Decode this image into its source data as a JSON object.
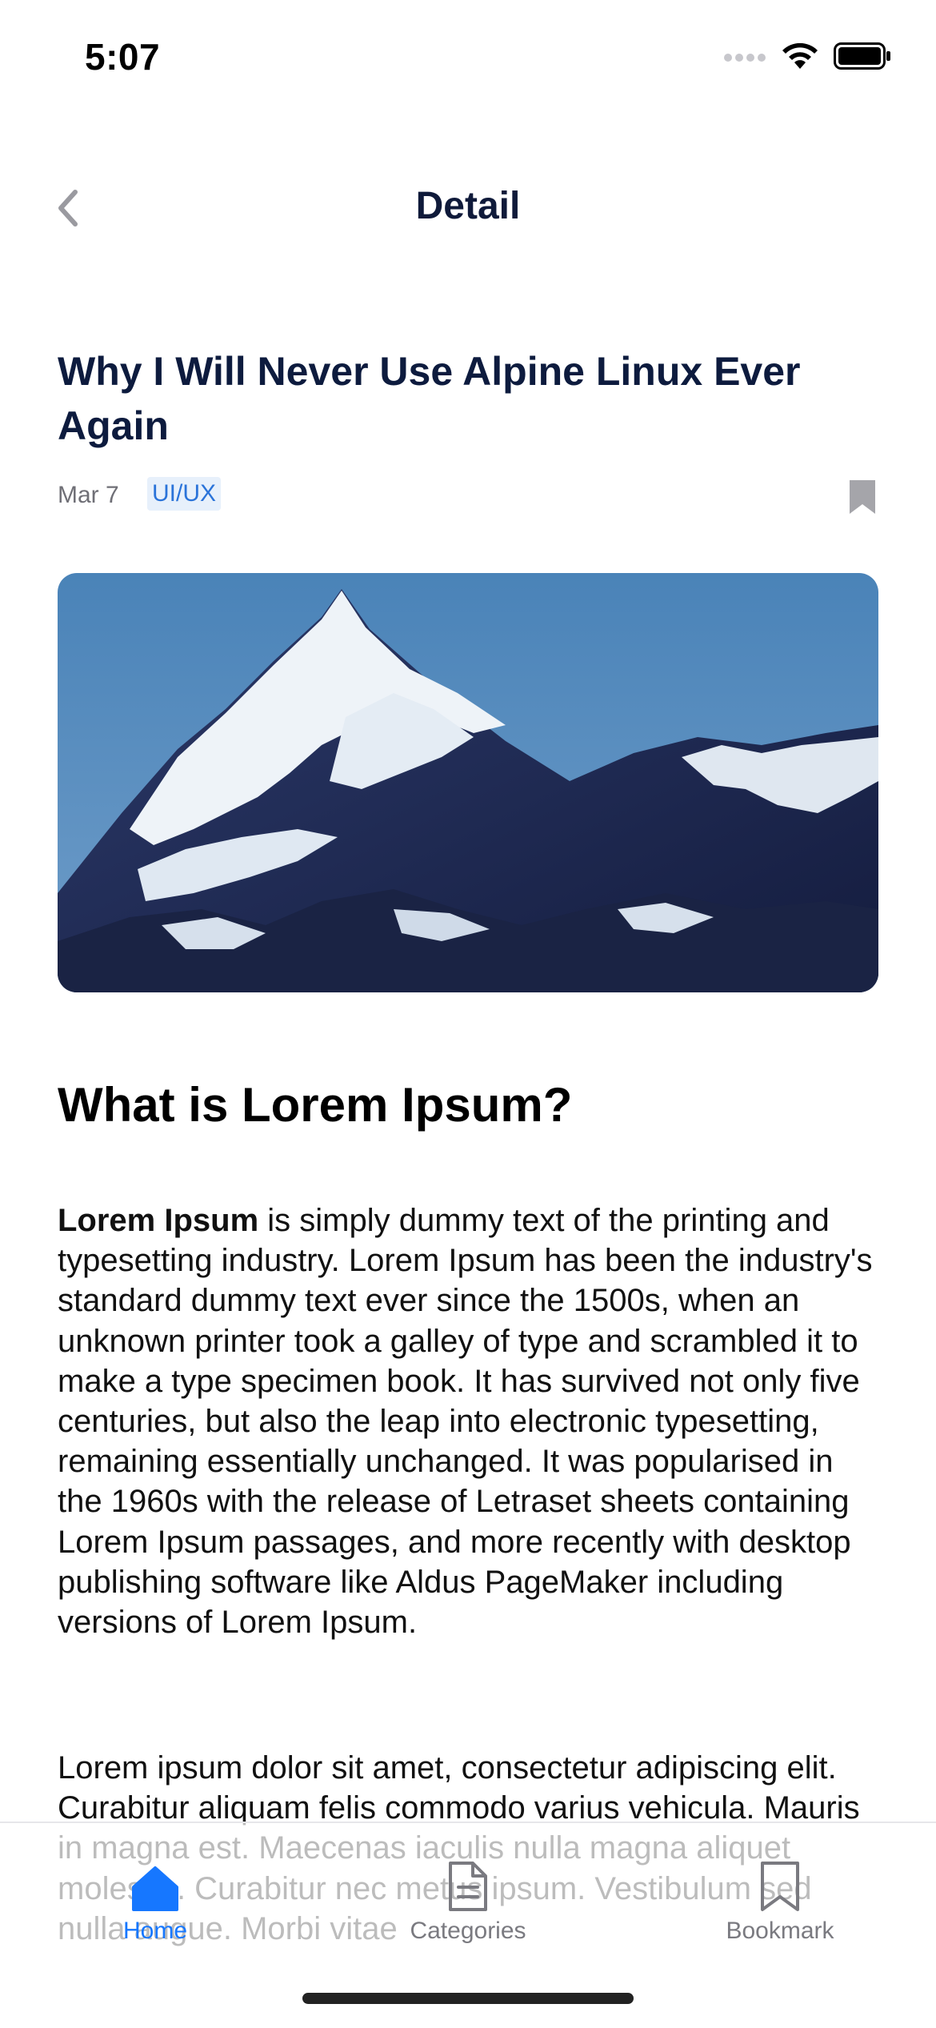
{
  "status_bar": {
    "time": "5:07",
    "icons": [
      "cellular-icon",
      "wifi-icon",
      "battery-icon"
    ]
  },
  "header": {
    "title": "Detail",
    "back_icon": "chevron-left-icon"
  },
  "article": {
    "title": "Why I Will Never Use Alpine Linux Ever Again",
    "date": "Mar 7",
    "category_tag": "UI/UX",
    "bookmark_icon": "bookmark-filled-icon",
    "hero_image": "snowy-mountain-peak-image",
    "section_heading": "What is Lorem Ipsum?",
    "paragraph1_bold": "Lorem Ipsum",
    "paragraph1_rest": " is simply dummy text of the printing and typesetting industry. Lorem Ipsum has been the industry's standard dummy text ever since the 1500s, when an unknown printer took a galley of type and scrambled it to make a type specimen book. It has survived not only five centuries, but also the leap into electronic typesetting, remaining essentially unchanged. It was popularised in the 1960s with the release of Letraset sheets containing Lorem Ipsum passages, and more recently with desktop publishing software like Aldus PageMaker including versions of Lorem Ipsum.",
    "paragraph2": "Lorem ipsum dolor sit amet, consectetur adipiscing elit. Curabitur aliquam felis commodo varius vehicula. Mauris in magna est. Maecenas iaculis nulla magna aliquet molestie. Curabitur nec metus ipsum. Vestibulum sed nulla augue. Morbi vitae"
  },
  "tab_bar": {
    "items": [
      {
        "label": "Home",
        "icon": "home-icon",
        "active": true
      },
      {
        "label": "Categories",
        "icon": "document-icon",
        "active": false
      },
      {
        "label": "Bookmark",
        "icon": "bookmark-outline-icon",
        "active": false
      }
    ]
  },
  "colors": {
    "accent": "#1677ff",
    "title": "#0d1b3e",
    "tag_bg": "#e7f0fb",
    "muted": "#6f6f76"
  }
}
